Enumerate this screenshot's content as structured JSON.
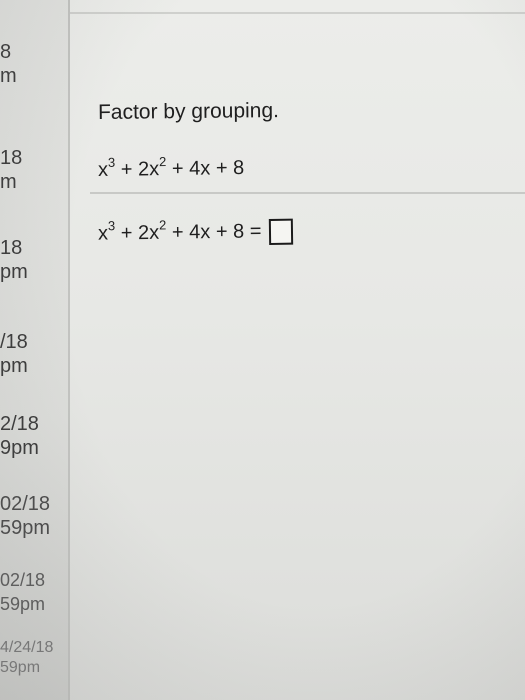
{
  "sidebar": {
    "items": [
      {
        "date": "8",
        "time": "m"
      },
      {
        "date": "18",
        "time": "m"
      },
      {
        "date": "18",
        "time": "pm"
      },
      {
        "date": "/18",
        "time": "pm"
      },
      {
        "date": "2/18",
        "time": "9pm"
      },
      {
        "date": "02/18",
        "time": "59pm"
      },
      {
        "date": "02/18",
        "time": "59pm"
      },
      {
        "date": "4/24/18",
        "time": "59pm"
      }
    ]
  },
  "question": {
    "instruction": "Factor by grouping.",
    "expression": {
      "x": "x",
      "exp1": "3",
      "t2": "+ 2x",
      "exp2": "2",
      "rest": "+ 4x + 8"
    },
    "answer_line": {
      "x": "x",
      "exp1": "3",
      "t2": "+ 2x",
      "exp2": "2",
      "rest": "+ 4x + 8 ="
    }
  }
}
